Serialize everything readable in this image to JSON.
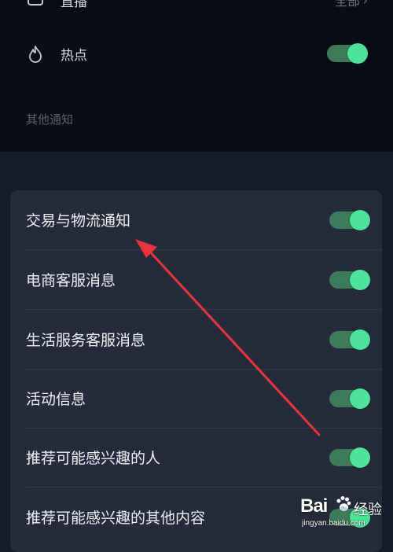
{
  "top_rows": [
    {
      "label": "直播",
      "value": "全部",
      "icon": "tv-icon"
    },
    {
      "label": "热点",
      "icon": "flame-icon",
      "enabled": true
    }
  ],
  "section_title": "其他通知",
  "settings": [
    {
      "label": "交易与物流通知",
      "enabled": true
    },
    {
      "label": "电商客服消息",
      "enabled": true
    },
    {
      "label": "生活服务客服消息",
      "enabled": true
    },
    {
      "label": "活动信息",
      "enabled": true
    },
    {
      "label": "推荐可能感兴趣的人",
      "enabled": true
    },
    {
      "label": "推荐可能感兴趣的其他内容",
      "enabled": true
    }
  ],
  "annotation": {
    "type": "arrow",
    "color": "#e8343a"
  },
  "watermark": {
    "logo_text": "Bai",
    "logo_suffix": "du",
    "brand": "经验",
    "url": "jingyan.baidu.com"
  },
  "colors": {
    "toggle_on_track": "#3c7a5a",
    "toggle_on_knob": "#4ee39a",
    "card_bg": "#252b3a"
  }
}
